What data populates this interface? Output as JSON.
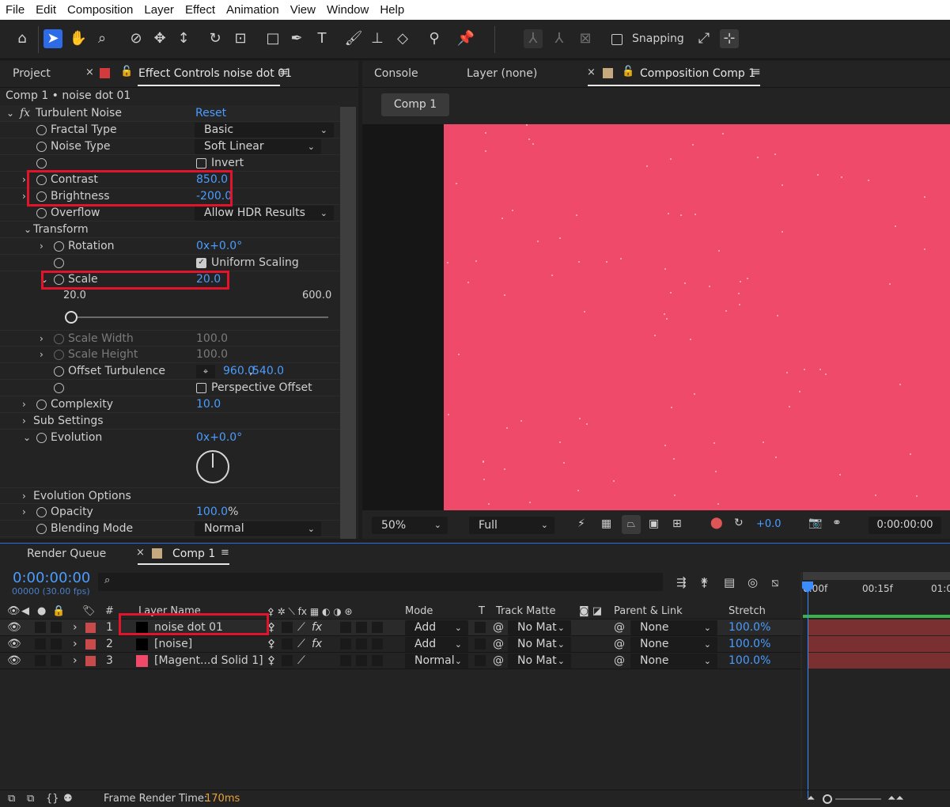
{
  "menu": [
    "File",
    "Edit",
    "Composition",
    "Layer",
    "Effect",
    "Animation",
    "View",
    "Window",
    "Help"
  ],
  "toolbar": {
    "snapping_label": "Snapping"
  },
  "left_panel": {
    "tabs": {
      "project": "Project",
      "effect_controls": "Effect Controls noise dot 01"
    },
    "breadcrumb": "Comp 1 • noise dot 01",
    "effect_name": "Turbulent Noise",
    "reset": "Reset",
    "fx": "fx",
    "props": {
      "fractal_type": {
        "label": "Fractal Type",
        "value": "Basic"
      },
      "noise_type": {
        "label": "Noise Type",
        "value": "Soft Linear"
      },
      "invert": {
        "label": "Invert"
      },
      "contrast": {
        "label": "Contrast",
        "value": "850.0"
      },
      "brightness": {
        "label": "Brightness",
        "value": "-200.0"
      },
      "overflow": {
        "label": "Overflow",
        "value": "Allow HDR Results"
      },
      "transform": {
        "label": "Transform"
      },
      "rotation": {
        "label": "Rotation",
        "value": "0x+0.0°"
      },
      "uniform_scaling": {
        "label": "Uniform Scaling"
      },
      "scale": {
        "label": "Scale",
        "value": "20.0",
        "min": "20.0",
        "max": "600.0",
        "fraction": 0.0
      },
      "scale_width": {
        "label": "Scale Width",
        "value": "100.0"
      },
      "scale_height": {
        "label": "Scale Height",
        "value": "100.0"
      },
      "offset_turbulence": {
        "label": "Offset Turbulence",
        "value_x": "960.0",
        "value_y": "540.0"
      },
      "perspective_offset": {
        "label": "Perspective Offset"
      },
      "complexity": {
        "label": "Complexity",
        "value": "10.0"
      },
      "sub_settings": {
        "label": "Sub Settings"
      },
      "evolution": {
        "label": "Evolution",
        "value": "0x+0.0°"
      },
      "evolution_options": {
        "label": "Evolution Options"
      },
      "opacity": {
        "label": "Opacity",
        "value": "100.0",
        "unit": "%"
      },
      "blending_mode": {
        "label": "Blending Mode",
        "value": "Normal"
      }
    }
  },
  "right_panel": {
    "tabs": {
      "console": "Console",
      "layer": "Layer (none)",
      "composition": "Composition Comp 1"
    },
    "comp_tab": "Comp 1",
    "canvas_color": "#f04a6a",
    "zoom": "50%",
    "resolution": "Full",
    "exposure": "+0.0",
    "timecode": "0:00:00:00"
  },
  "timeline": {
    "tabs": {
      "render_queue": "Render Queue",
      "comp": "Comp 1"
    },
    "timecode": "0:00:00:00",
    "frames": "00000 (30.00 fps)",
    "columns": {
      "num": "#",
      "layer_name": "Layer Name",
      "mode": "Mode",
      "t": "T",
      "track_matte": "Track Matte",
      "parent": "Parent & Link",
      "stretch": "Stretch"
    },
    "ruler": [
      "0:00f",
      "00:15f",
      "01:0"
    ],
    "layers": [
      {
        "num": "1",
        "name": "noise dot 01",
        "mode": "Add",
        "matte": "No Mat",
        "parent": "None",
        "stretch": "100.0%",
        "fx": "fx",
        "swatch": "#000000"
      },
      {
        "num": "2",
        "name": "[noise]",
        "mode": "Add",
        "matte": "No Mat",
        "parent": "None",
        "stretch": "100.0%",
        "fx": "fx",
        "swatch": "#000000"
      },
      {
        "num": "3",
        "name": "[Magent...d Solid 1]",
        "mode": "Normal",
        "matte": "No Mat",
        "parent": "None",
        "stretch": "100.0%",
        "fx": "",
        "swatch": "#f04a6a"
      }
    ],
    "footer": {
      "label": "Frame Render Time:",
      "value": "170ms"
    }
  }
}
